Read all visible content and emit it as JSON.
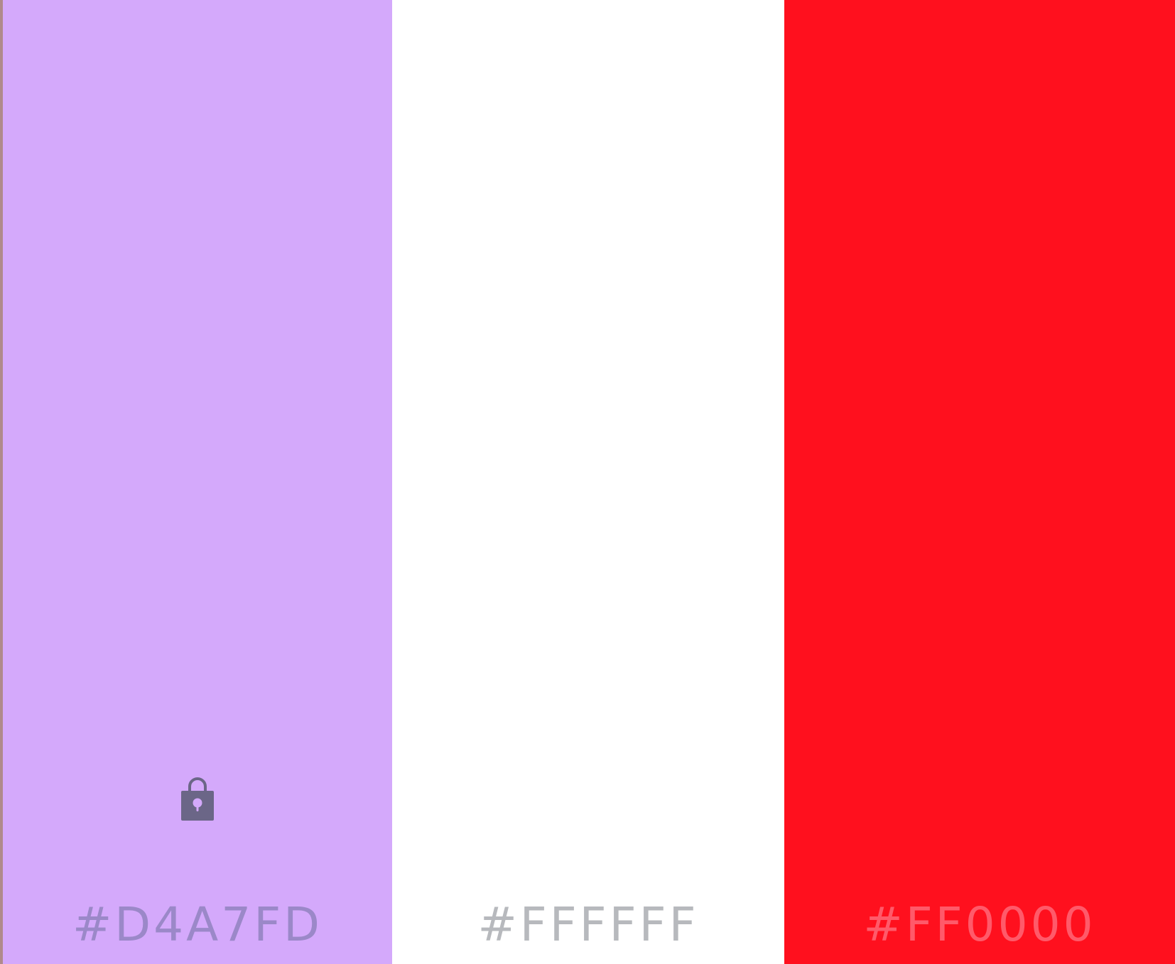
{
  "palette": {
    "swatches": [
      {
        "hex": "#D4A7FD",
        "label": "#D4A7FD",
        "label_color": "#9b88c8",
        "locked": true
      },
      {
        "hex": "#FFFFFF",
        "label": "#FFFFFF",
        "label_color": "#b7b9bd",
        "locked": false
      },
      {
        "hex": "#FF0000",
        "label": "#FF0000",
        "label_color": "#ff5a6a",
        "locked": false
      }
    ],
    "lock_icon": "lock-icon",
    "lock_icon_color": "#6b6687",
    "edge_color": "#b08a8c",
    "swatch_display_colors": [
      "#d4a9fb",
      "#ffffff",
      "#ff101e"
    ]
  }
}
